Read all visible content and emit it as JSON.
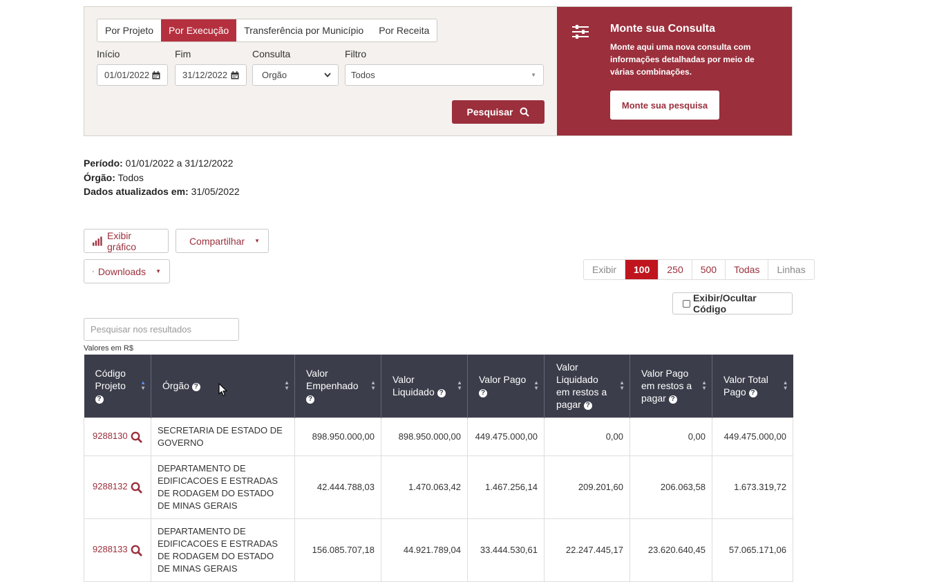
{
  "tabs": [
    "Por Projeto",
    "Por Execução",
    "Transferência por Município",
    "Por Receita"
  ],
  "active_tab": "Por Execução",
  "form": {
    "inicio_label": "Início",
    "inicio_value": "01/01/2022",
    "fim_label": "Fim",
    "fim_value": "31/12/2022",
    "consulta_label": "Consulta",
    "consulta_value": "Orgão",
    "filtro_label": "Filtro",
    "filtro_value": "Todos",
    "search_label": "Pesquisar"
  },
  "monte": {
    "title": "Monte sua Consulta",
    "description": "Monte aqui uma nova consulta com informações detalhadas por meio de várias combinações.",
    "button": "Monte sua pesquisa"
  },
  "info": {
    "periodo_label": "Período:",
    "periodo_value": " 01/01/2022 a 31/12/2022",
    "orgao_label": "Órgão:",
    "orgao_value": " Todos",
    "atualizado_label": "Dados atualizados em:",
    "atualizado_value": " 31/05/2022"
  },
  "toolbar": {
    "grafico": "Exibir gráfico",
    "compartilhar": "Compartilhar",
    "downloads": "Downloads"
  },
  "pager": {
    "exibir": "Exibir",
    "options": [
      "100",
      "250",
      "500",
      "Todas"
    ],
    "selected": "100",
    "linhas": "Linhas"
  },
  "toggle_code": "Exibir/Ocultar Código",
  "filter_placeholder": "Pesquisar nos resultados",
  "units": "Valores em R$",
  "table": {
    "headers": [
      "Código Projeto",
      "Órgão",
      "Valor Empenhado",
      "Valor Liquidado",
      "Valor Pago",
      "Valor Liquidado em restos a pagar",
      "Valor Pago em restos a pagar",
      "Valor Total Pago"
    ],
    "rows": [
      [
        "9288130",
        "SECRETARIA DE ESTADO DE GOVERNO",
        "898.950.000,00",
        "898.950.000,00",
        "449.475.000,00",
        "0,00",
        "0,00",
        "449.475.000,00"
      ],
      [
        "9288132",
        "DEPARTAMENTO DE EDIFICACOES E ESTRADAS DE RODAGEM DO ESTADO DE MINAS GERAIS",
        "42.444.788,03",
        "1.470.063,42",
        "1.467.256,14",
        "209.201,60",
        "206.063,58",
        "1.673.319,72"
      ],
      [
        "9288133",
        "DEPARTAMENTO DE EDIFICACOES E ESTRADAS DE RODAGEM DO ESTADO DE MINAS GERAIS",
        "156.085.707,18",
        "44.921.789,04",
        "33.444.530,61",
        "22.247.445,17",
        "23.620.640,45",
        "57.065.171,06"
      ]
    ]
  },
  "colors": {
    "brand": "#9b2f3c",
    "header_bg": "#3b3d4a",
    "pager_selected": "#c0151e",
    "panel_bg": "#f4f1ee"
  }
}
